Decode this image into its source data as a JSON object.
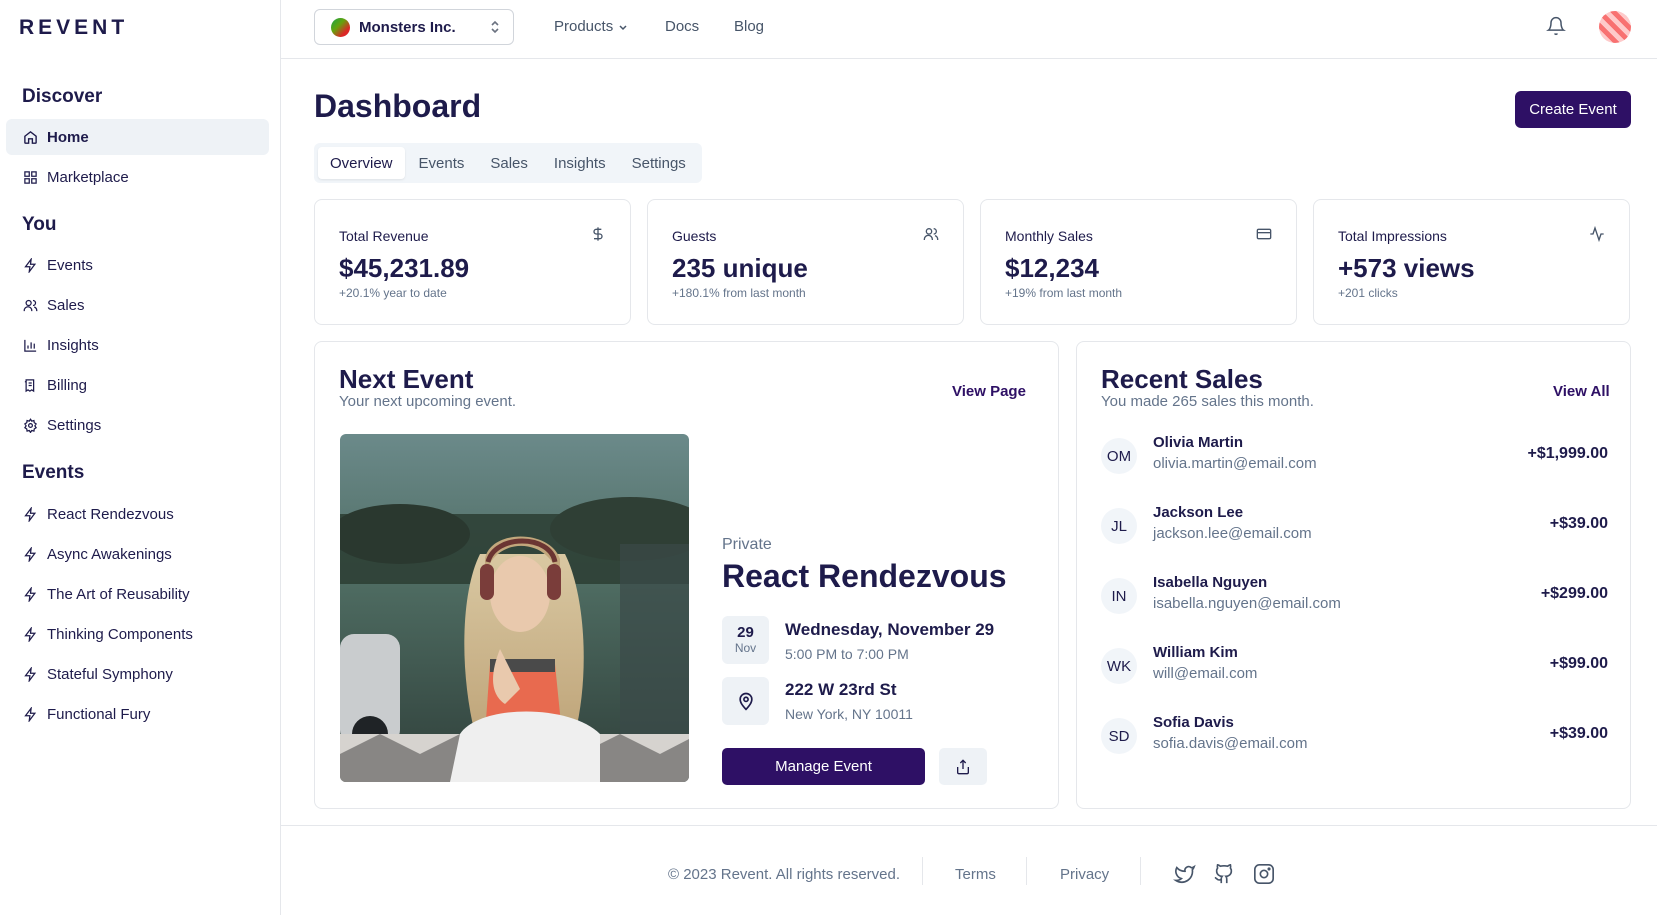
{
  "brand": {
    "logo": "REVENT"
  },
  "topbar": {
    "org": "Monsters Inc.",
    "nav": [
      "Products",
      "Docs",
      "Blog"
    ]
  },
  "sidebar": {
    "sections": [
      {
        "heading": "Discover",
        "items": [
          {
            "label": "Home",
            "icon": "home-icon",
            "active": true
          },
          {
            "label": "Marketplace",
            "icon": "grid-icon"
          }
        ]
      },
      {
        "heading": "You",
        "items": [
          {
            "label": "Events",
            "icon": "bolt-icon"
          },
          {
            "label": "Sales",
            "icon": "users-icon"
          },
          {
            "label": "Insights",
            "icon": "bar-chart-icon"
          },
          {
            "label": "Billing",
            "icon": "receipt-icon"
          },
          {
            "label": "Settings",
            "icon": "gear-icon"
          }
        ]
      },
      {
        "heading": "Events",
        "items": [
          {
            "label": "React Rendezvous",
            "icon": "bolt-icon"
          },
          {
            "label": "Async Awakenings",
            "icon": "bolt-icon"
          },
          {
            "label": "The Art of Reusability",
            "icon": "bolt-icon"
          },
          {
            "label": "Thinking Components",
            "icon": "bolt-icon"
          },
          {
            "label": "Stateful Symphony",
            "icon": "bolt-icon"
          },
          {
            "label": "Functional Fury",
            "icon": "bolt-icon"
          }
        ]
      }
    ]
  },
  "main": {
    "title": "Dashboard",
    "create_button": "Create Event",
    "tabs": [
      "Overview",
      "Events",
      "Sales",
      "Insights",
      "Settings"
    ],
    "active_tab": "Overview",
    "stats": [
      {
        "label": "Total Revenue",
        "value": "$45,231.89",
        "sub": "+20.1% year to date",
        "icon": "dollar-icon"
      },
      {
        "label": "Guests",
        "value": "235 unique",
        "sub": "+180.1% from last month",
        "icon": "users-icon"
      },
      {
        "label": "Monthly Sales",
        "value": "$12,234",
        "sub": "+19% from last month",
        "icon": "credit-card-icon"
      },
      {
        "label": "Total Impressions",
        "value": "+573 views",
        "sub": "+201 clicks",
        "icon": "activity-icon"
      }
    ],
    "next_event": {
      "title": "Next Event",
      "subtitle": "Your next upcoming event.",
      "link": "View Page",
      "visibility": "Private",
      "name": "React Rendezvous",
      "day": "29",
      "month": "Nov",
      "date_line": "Wednesday, November 29",
      "time_line": "5:00 PM to 7:00 PM",
      "address": "222 W 23rd St",
      "city": "New York, NY 10011",
      "manage_button": "Manage Event"
    },
    "recent_sales": {
      "title": "Recent Sales",
      "subtitle": "You made 265 sales this month.",
      "link": "View All",
      "rows": [
        {
          "initials": "OM",
          "name": "Olivia Martin",
          "email": "olivia.martin@email.com",
          "amount": "+$1,999.00"
        },
        {
          "initials": "JL",
          "name": "Jackson Lee",
          "email": "jackson.lee@email.com",
          "amount": "+$39.00"
        },
        {
          "initials": "IN",
          "name": "Isabella Nguyen",
          "email": "isabella.nguyen@email.com",
          "amount": "+$299.00"
        },
        {
          "initials": "WK",
          "name": "William Kim",
          "email": "will@email.com",
          "amount": "+$99.00"
        },
        {
          "initials": "SD",
          "name": "Sofia Davis",
          "email": "sofia.davis@email.com",
          "amount": "+$39.00"
        }
      ]
    }
  },
  "footer": {
    "copyright": "© 2023 Revent. All rights reserved.",
    "links": [
      "Terms",
      "Privacy"
    ],
    "social": [
      "twitter-icon",
      "github-icon",
      "instagram-icon"
    ]
  },
  "colors": {
    "accent": "#2e1065",
    "text": "#1e1b4b",
    "muted": "#64748b",
    "border": "#e5e7eb"
  }
}
